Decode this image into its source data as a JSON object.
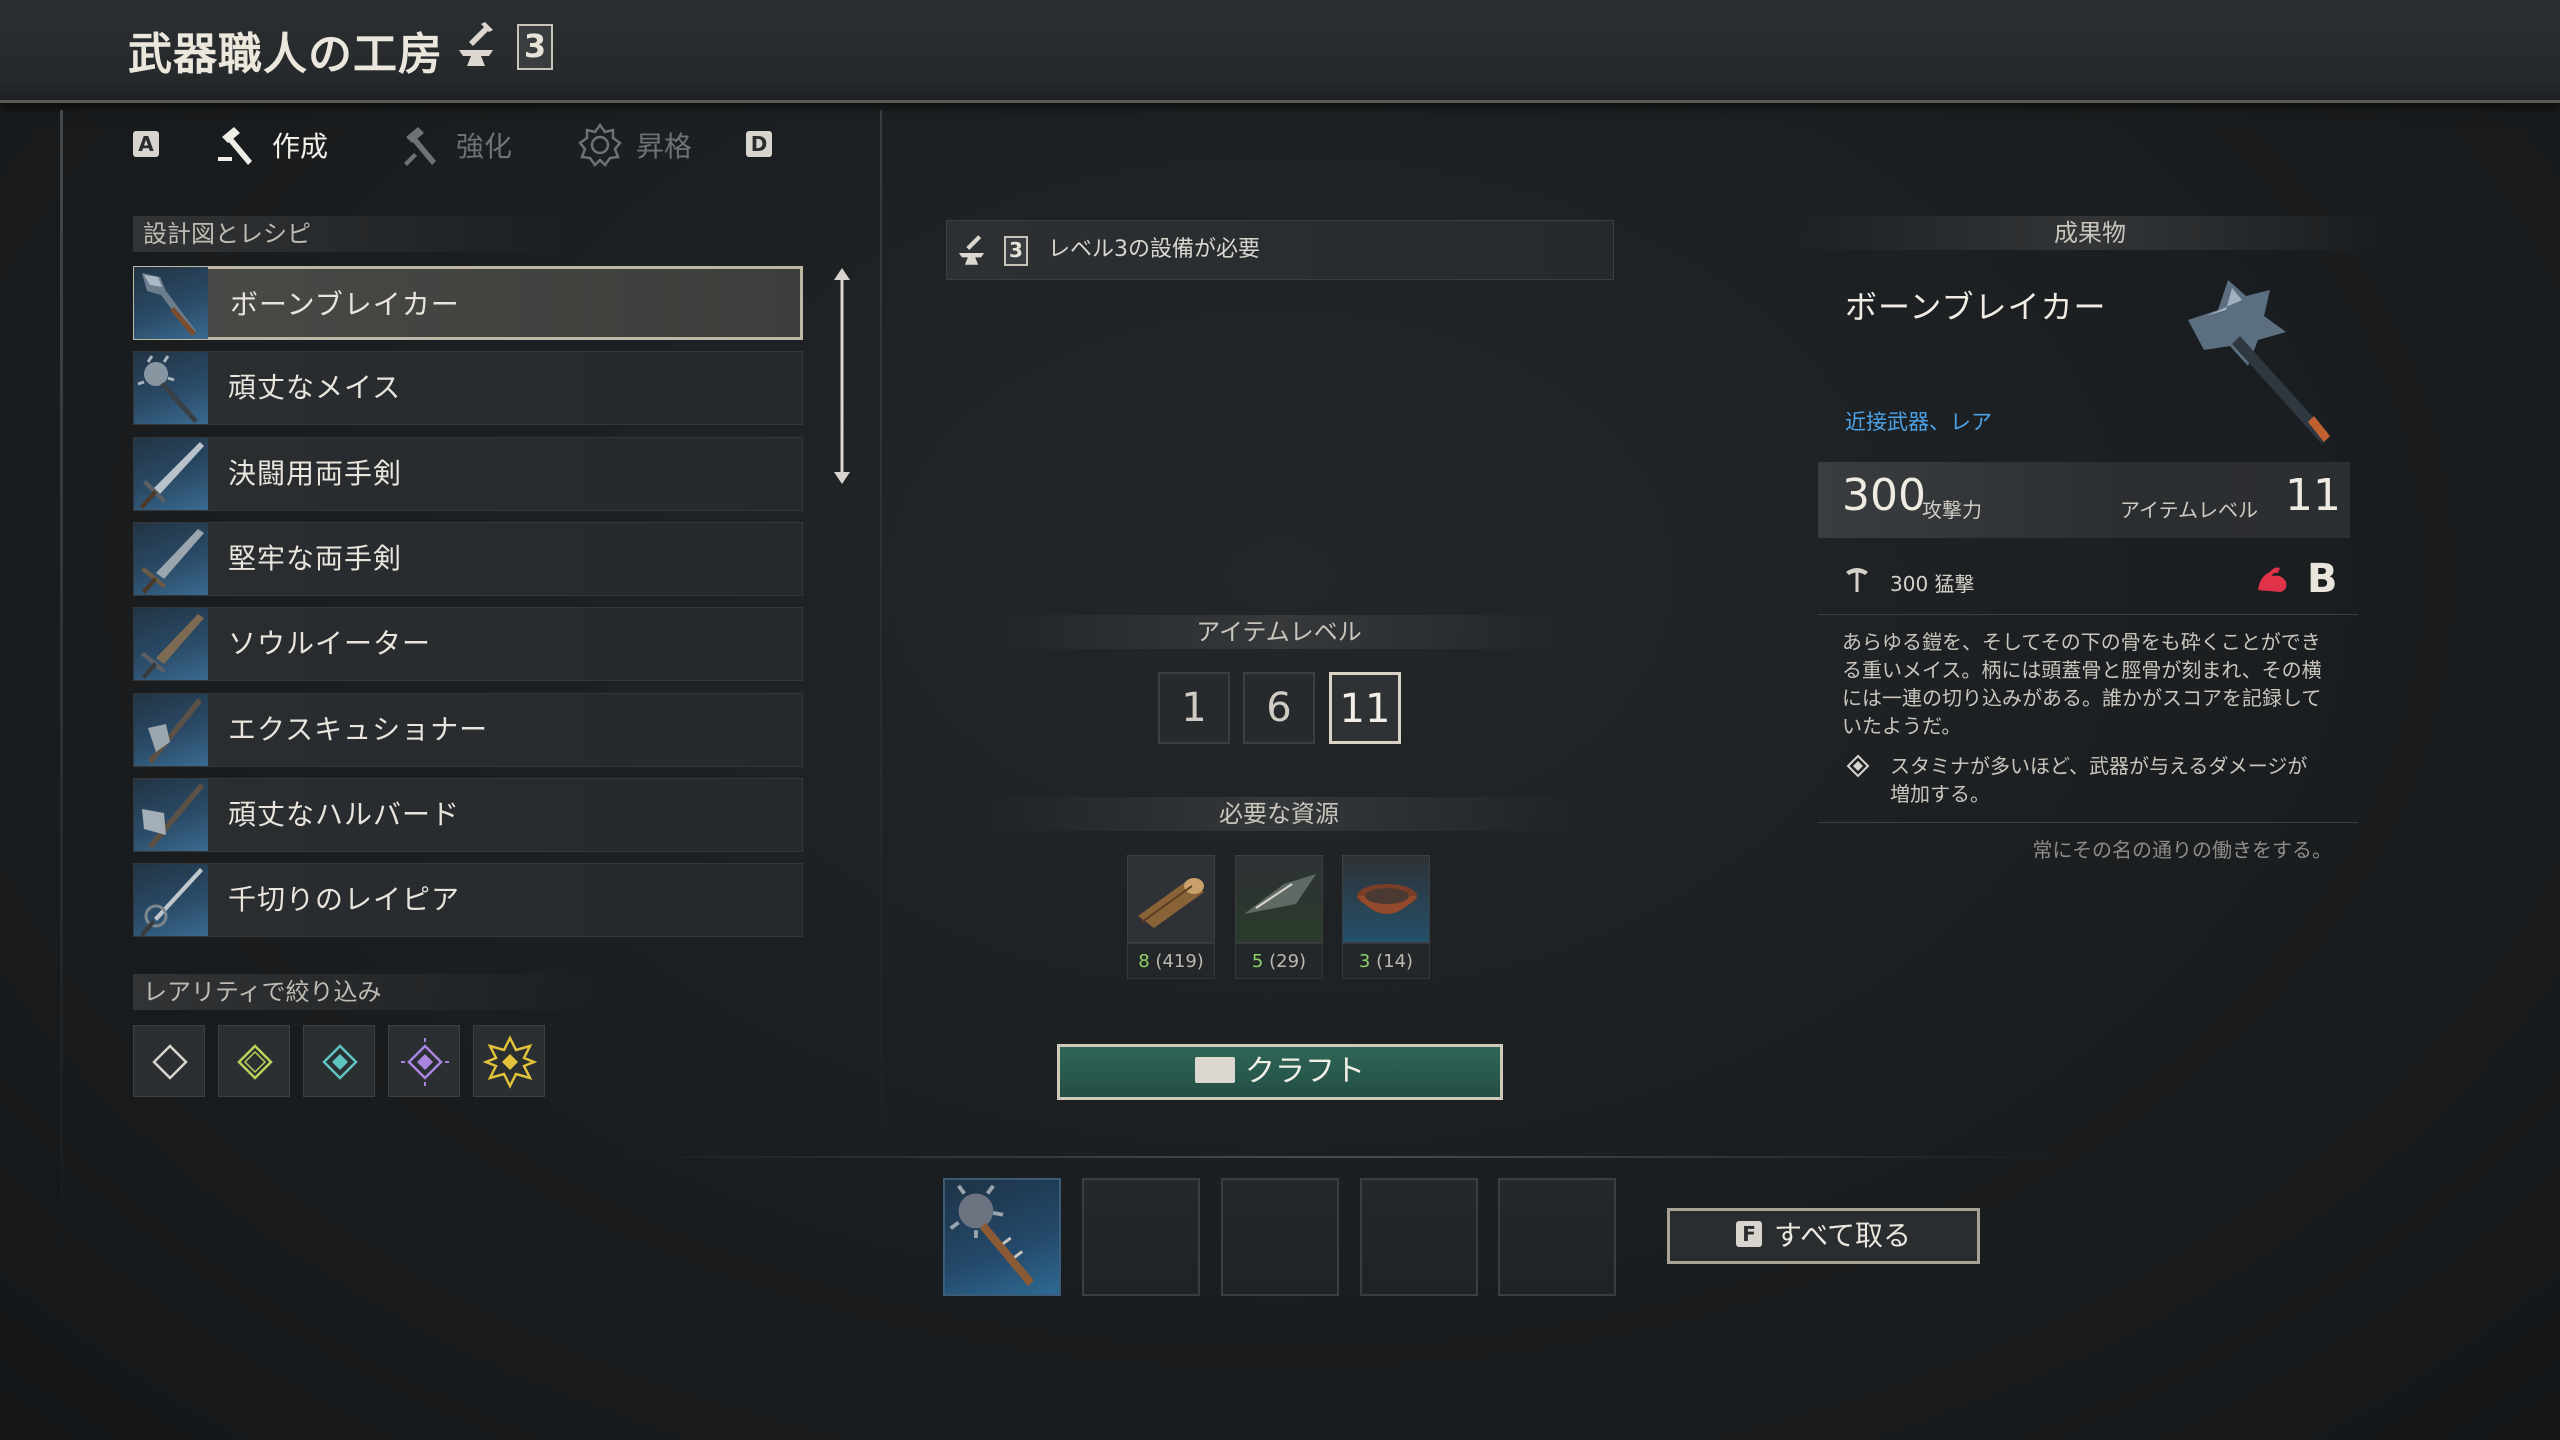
{
  "header": {
    "title": "武器職人の工房",
    "station_level": "3"
  },
  "tabs": {
    "prev_key": "A",
    "next_key": "D",
    "items": [
      {
        "label": "作成",
        "icon": "hammer-icon",
        "active": true
      },
      {
        "label": "強化",
        "icon": "hammer-icon",
        "active": false
      },
      {
        "label": "昇格",
        "icon": "gear-icon",
        "active": false
      }
    ]
  },
  "recipes": {
    "section_label": "設計図とレシピ",
    "items": [
      {
        "label": "ボーンブレイカー",
        "selected": true
      },
      {
        "label": "頑丈なメイス"
      },
      {
        "label": "決闘用両手剣"
      },
      {
        "label": "堅牢な両手剣"
      },
      {
        "label": "ソウルイーター"
      },
      {
        "label": "エクスキュショナー"
      },
      {
        "label": "頑丈なハルバード"
      },
      {
        "label": "千切りのレイピア"
      }
    ]
  },
  "rarity_filter": {
    "label": "レアリティで絞り込み",
    "colors": [
      "#d8d5cf",
      "#b9d35a",
      "#5fc4c0",
      "#a985e0",
      "#e2c23a"
    ]
  },
  "requirement": {
    "level": "3",
    "text": "レベル3の設備が必要"
  },
  "item_level": {
    "label": "アイテムレベル",
    "options": [
      "1",
      "6",
      "11"
    ],
    "selected": "11"
  },
  "resources": {
    "label": "必要な資源",
    "items": [
      {
        "icon": "wood-log-icon",
        "required": "8",
        "owned": "(419)"
      },
      {
        "icon": "leather-scrap-icon",
        "required": "5",
        "owned": "(29)"
      },
      {
        "icon": "bowl-icon",
        "required": "3",
        "owned": "(14)"
      }
    ]
  },
  "craft_button": {
    "label": "クラフト"
  },
  "take_all": {
    "key": "F",
    "label": "すべて取る"
  },
  "output_slots": {
    "filled_count": 1,
    "total": 5
  },
  "result": {
    "label": "成果物",
    "name": "ボーンブレイカー",
    "type": "近接武器、レア",
    "attack": "300",
    "attack_label": "攻撃力",
    "item_level_label": "アイテムレベル",
    "item_level": "11",
    "strike": "300 猛撃",
    "scaling_grade": "B",
    "description": "あらゆる鎧を、そしてその下の骨をも砕くことができる重いメイス。柄には頭蓋骨と脛骨が刻まれ、その横には一連の切り込みがある。誰かがスコアを記録していたようだ。",
    "perk": "スタミナが多いほど、武器が与えるダメージが増加する。",
    "flavor": "常にその名の通りの働きをする。"
  },
  "colors": {
    "accent_green": "#2f6658",
    "type_blue": "#4da3e8",
    "count_green": "#8fd16a"
  }
}
